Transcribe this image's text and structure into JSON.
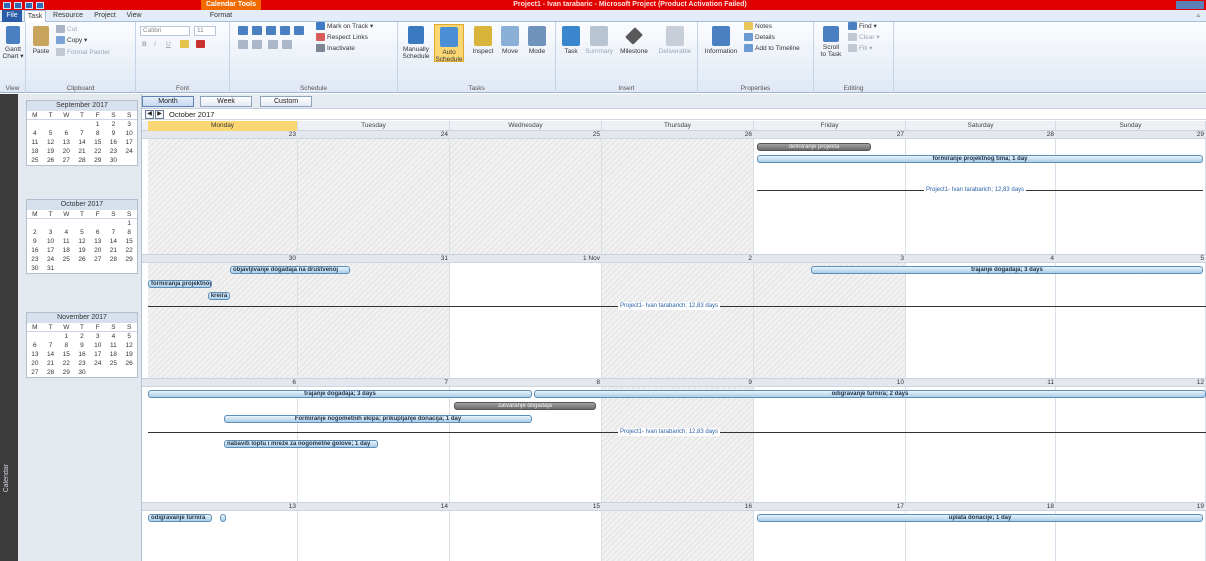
{
  "window": {
    "title": "Project1 - Ivan tarabaric  -  Microsoft Project (Product Activation Failed)",
    "context_tab": "Calendar Tools"
  },
  "tabs": {
    "file": "File",
    "task": "Task",
    "resource": "Resource",
    "project": "Project",
    "view": "View",
    "format": "Format",
    "collapse": "▵"
  },
  "ribbon": {
    "view_group": {
      "gantt": "Gantt",
      "chart": "Chart ▾",
      "label": "View"
    },
    "clipboard": {
      "paste": "Paste",
      "cut": "Cut",
      "copy": "Copy ▾",
      "format_painter": "Format Painter",
      "label": "Clipboard"
    },
    "font": {
      "family": "Calibri",
      "size": "11",
      "bold": "B",
      "italic": "I",
      "underline": "U",
      "label": "Font"
    },
    "schedule": {
      "mark_on_track": "Mark on Track ▾",
      "respect_links": "Respect Links",
      "inactivate": "Inactivate",
      "label": "Schedule"
    },
    "tasks": {
      "manually": "Manually",
      "manually2": "Schedule",
      "auto": "Auto",
      "auto2": "Schedule",
      "inspect": "Inspect",
      "move": "Move",
      "mode": "Mode",
      "label": "Tasks"
    },
    "insert": {
      "task": "Task",
      "summary": "Summary",
      "milestone": "Milestone",
      "deliverable": "Deliverable",
      "label": "Insert"
    },
    "properties": {
      "information": "Information",
      "notes": "Notes",
      "details": "Details",
      "add_timeline": "Add to Timeline",
      "label": "Properties"
    },
    "editing": {
      "scroll": "Scroll",
      "to_task": "to Task",
      "find": "Find ▾",
      "clear": "Clear ▾",
      "fill": "Fill ▾",
      "label": "Editing"
    }
  },
  "sidebar": {
    "label": "Calendar"
  },
  "minicals": [
    {
      "title": "September 2017",
      "rows": [
        [
          "",
          "",
          "",
          "",
          "1",
          "2",
          "3"
        ],
        [
          "4",
          "5",
          "6",
          "7",
          "8",
          "9",
          "10"
        ],
        [
          "11",
          "12",
          "13",
          "14",
          "15",
          "16",
          "17"
        ],
        [
          "18",
          "19",
          "20",
          "21",
          "22",
          "23",
          "24"
        ],
        [
          "25",
          "26",
          "27",
          "28",
          "29",
          "30",
          ""
        ]
      ]
    },
    {
      "title": "October 2017",
      "rows": [
        [
          "",
          "",
          "",
          "",
          "",
          "",
          "1"
        ],
        [
          "2",
          "3",
          "4",
          "5",
          "6",
          "7",
          "8"
        ],
        [
          "9",
          "10",
          "11",
          "12",
          "13",
          "14",
          "15"
        ],
        [
          "16",
          "17",
          "18",
          "19",
          "20",
          "21",
          "22"
        ],
        [
          "23",
          "24",
          "25",
          "26",
          "27",
          "28",
          "29"
        ],
        [
          "30",
          "31",
          "",
          "",
          "",
          "",
          ""
        ]
      ]
    },
    {
      "title": "November 2017",
      "rows": [
        [
          "",
          "",
          "1",
          "2",
          "3",
          "4",
          "5"
        ],
        [
          "6",
          "7",
          "8",
          "9",
          "10",
          "11",
          "12"
        ],
        [
          "13",
          "14",
          "15",
          "16",
          "17",
          "18",
          "19"
        ],
        [
          "20",
          "21",
          "22",
          "23",
          "24",
          "25",
          "26"
        ],
        [
          "27",
          "28",
          "29",
          "30",
          "",
          "",
          ""
        ]
      ]
    }
  ],
  "weekday_short": [
    "M",
    "T",
    "W",
    "T",
    "F",
    "S",
    "S"
  ],
  "viewbar": {
    "month": "Month",
    "week": "Week",
    "custom": "Custom",
    "prev": "◀",
    "next": "▶",
    "current": "October 2017"
  },
  "weekdays": [
    "Monday",
    "Tuesday",
    "Wednesday",
    "Thursday",
    "Friday",
    "Saturday",
    "Sunday"
  ],
  "weeks": [
    {
      "dates": [
        "23",
        "24",
        "25",
        "26",
        "27",
        "28",
        "29"
      ]
    },
    {
      "dates": [
        "30",
        "31",
        "1 Nov",
        "2",
        "3",
        "4",
        "5"
      ]
    },
    {
      "dates": [
        "6",
        "7",
        "8",
        "9",
        "10",
        "11",
        "12"
      ]
    },
    {
      "dates": [
        "13",
        "14",
        "15",
        "16",
        "17",
        "18",
        "19"
      ]
    }
  ],
  "tasks": {
    "w1_definiranje": "definiranje projekta",
    "w1_formiranje_tima": "formiranje projektnog tima; 1 day",
    "w1_project": "Project1- Ivan tarabarich; 12,83 days",
    "w2_objavljivanje": "objavljivanje događaja na društvenoj",
    "w2_formiranja": "formiranja projektnog",
    "w2_kreira": "kreira",
    "w2_trajanje": "trajanje događaja; 3 days",
    "w2_project": "Project1- Ivan tarabarich; 12,83 days",
    "w3_trajanje": "trajanje događaja; 3 days",
    "w3_odigravanje": "odigravanje turnira; 2 days",
    "w3_zatvaranje": "zatvaranje događaja",
    "w3_formiranje": "Formiranje nogometnih ekipa; prikupljanje donacija; 1 day",
    "w3_project": "Project1- Ivan tarabarich; 12,83 days",
    "w3_nabaviti": "nabaviti loptu i mreže za nogometne golove; 1 day",
    "w4_odigravanje": "odigravanje turnira",
    "w4_uplata": "uplata donacije; 1 day"
  }
}
